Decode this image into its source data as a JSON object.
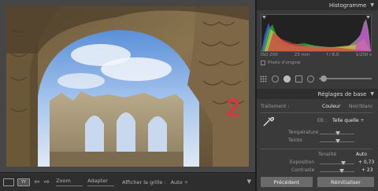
{
  "toolbar": {
    "zoom_label": "Zoom",
    "zoom_value": "Adapter",
    "grid_label": "Afficher la grille :",
    "grid_value": "Auto",
    "grid_view_glyph": "YY"
  },
  "photo": {
    "overlay_number": "2"
  },
  "histogram": {
    "title": "Histogramme",
    "iso": "ISO 200",
    "focal": "23 mm",
    "aperture": "f / 8,0",
    "shutter": "1/200 s",
    "original_photo": "Photo d'origine"
  },
  "basic": {
    "title": "Réglages de base",
    "treatment_label": "Traitement :",
    "treatment_color": "Couleur",
    "treatment_bw": "Noir/blanc",
    "wb_label": "EB :",
    "wb_value": "Telle quelle",
    "temperature": "Température",
    "tint": "Teinte",
    "tone_label": "Tonalité",
    "tone_auto": "Auto",
    "exposure": "Exposition",
    "exposure_value": "+ 0,73",
    "contrast": "Contraste",
    "contrast_value": "+ 23"
  },
  "buttons": {
    "previous": "Précédent",
    "reset": "Réinitialiser"
  },
  "colors": {
    "annotation": "#d13a45",
    "panel_bg": "#3a3a3a",
    "header_bg": "#2e2e2e"
  },
  "icons": [
    "loupe-view-icon",
    "grid-view-icon",
    "back-arrow-icon",
    "forward-arrow-icon",
    "collapse-triangle-icon",
    "eyedropper-icon",
    "crop-grid-icon",
    "spot-removal-icon",
    "red-eye-icon",
    "graduated-filter-icon",
    "radial-filter-icon",
    "adjustment-brush-icon"
  ]
}
